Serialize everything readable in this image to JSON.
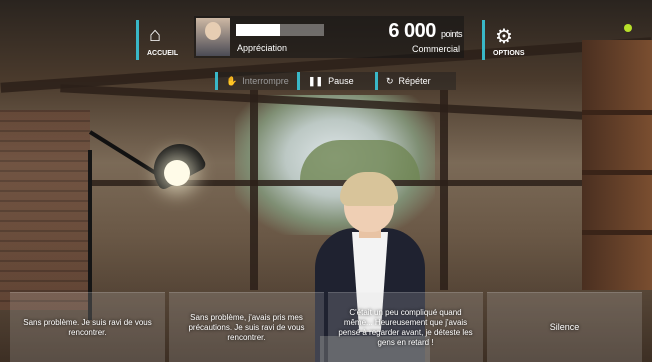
{
  "hud": {
    "home_label": "ACCUEIL",
    "options_label": "OPTIONS",
    "appreciation_label": "Appréciation",
    "points_value": "6 000",
    "points_unit": "points",
    "role_label": "Commercial"
  },
  "controls": {
    "interrupt_label": "Interrompre",
    "pause_label": "Pause",
    "repeat_label": "Répéter"
  },
  "choices": [
    {
      "text": "Sans problème. Je suis ravi de vous rencontrer."
    },
    {
      "text": "Sans problème, j'avais pris mes précautions. Je suis ravi de vous rencontrer."
    },
    {
      "text": "C'était un peu compliqué quand même... Heureusement que j'avais pensé à regarder avant, je déteste les gens en retard !"
    },
    {
      "text": "Silence"
    }
  ],
  "icons": {
    "home": "house-icon",
    "options": "gear-icon",
    "interrupt": "hand-icon",
    "pause": "pause-icon",
    "repeat": "repeat-icon"
  },
  "colors": {
    "accent": "#39b7c7",
    "status_dot": "#b8e02a"
  }
}
